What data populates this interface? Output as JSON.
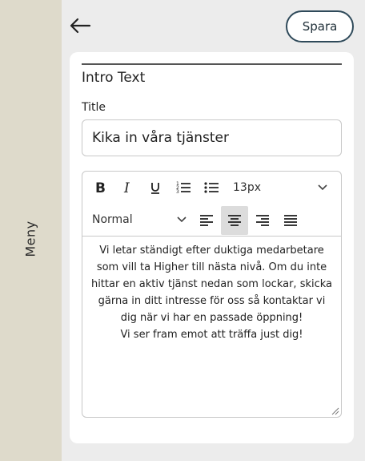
{
  "sidebar": {
    "label": "Meny"
  },
  "header": {
    "save_label": "Spara"
  },
  "section": {
    "title": "Intro Text"
  },
  "title_field": {
    "label": "Title",
    "value": "Kika in våra tjänster"
  },
  "editor": {
    "font_size": "13px",
    "block_style": "Normal",
    "active_alignment": "center",
    "content_lines": [
      "Vi letar ständigt efter duktiga medarbetare",
      "som vill ta Higher till nästa nivå. Om du inte",
      "hittar en aktiv tjänst nedan som lockar, skicka",
      "gärna in ditt intresse för oss så kontaktar vi",
      "dig när vi har en passade öppning!",
      "Vi ser fram emot att träffa just dig!"
    ]
  },
  "colors": {
    "sidebar": "#dedacb",
    "save_border": "#2f4a5a",
    "background": "#ececec",
    "active_tool": "#dcdcdc"
  }
}
